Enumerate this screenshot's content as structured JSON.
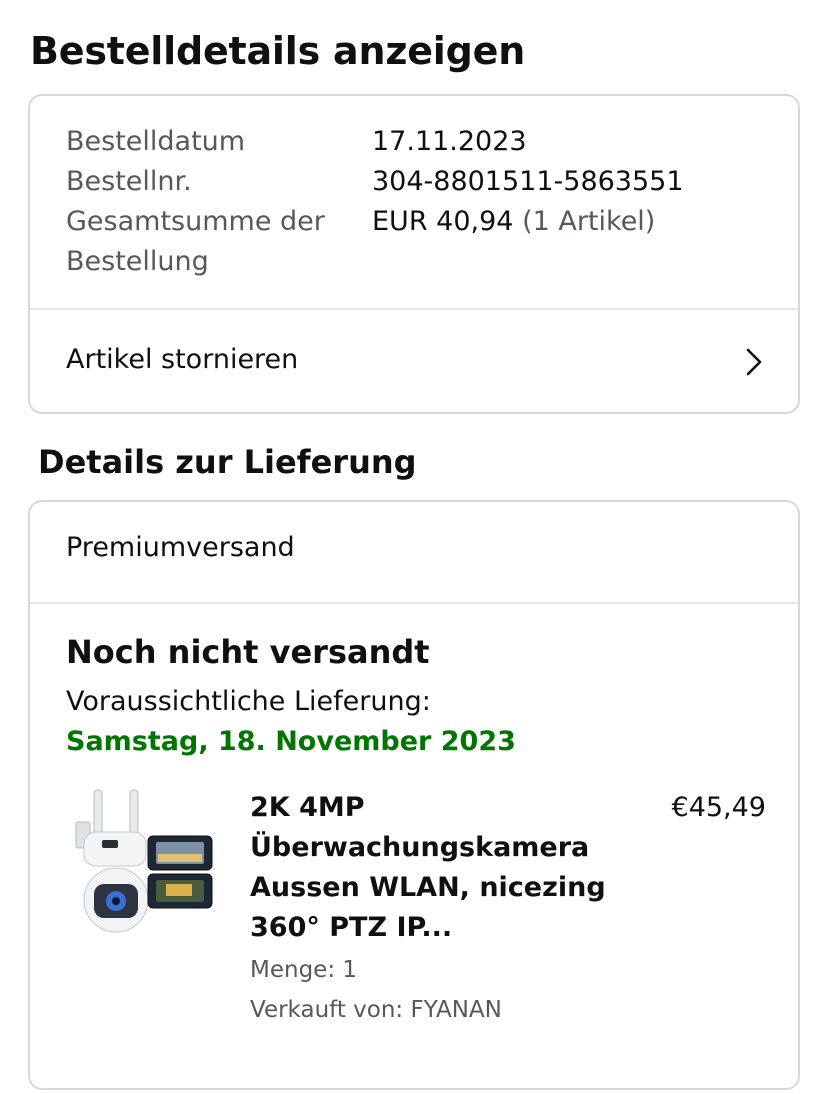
{
  "page": {
    "title": "Bestelldetails anzeigen"
  },
  "order": {
    "date_label": "Bestelldatum",
    "date_value": "17.11.2023",
    "number_label": "Bestellnr.",
    "number_value": "304-8801511-5863551",
    "total_label_line1": "Gesamtsumme der",
    "total_label_line2": "Bestellung",
    "total_value": "EUR 40,94",
    "total_items": "(1 Artikel)",
    "cancel_label": "Artikel stornieren"
  },
  "delivery": {
    "section_title": "Details zur Lieferung",
    "shipping_speed": "Premiumversand",
    "status": "Noch nicht versandt",
    "eta_label": "Voraussichtliche Lieferung:",
    "eta_date": "Samstag, 18. November 2023",
    "eta_color": "#007600"
  },
  "product": {
    "title_lines": [
      "2K 4MP",
      "Überwachungskamera",
      "Aussen WLAN, nicezing",
      "360° PTZ IP..."
    ],
    "price": "€45,49",
    "quantity": "Menge: 1",
    "seller": "Verkauft von: FYANAN"
  }
}
